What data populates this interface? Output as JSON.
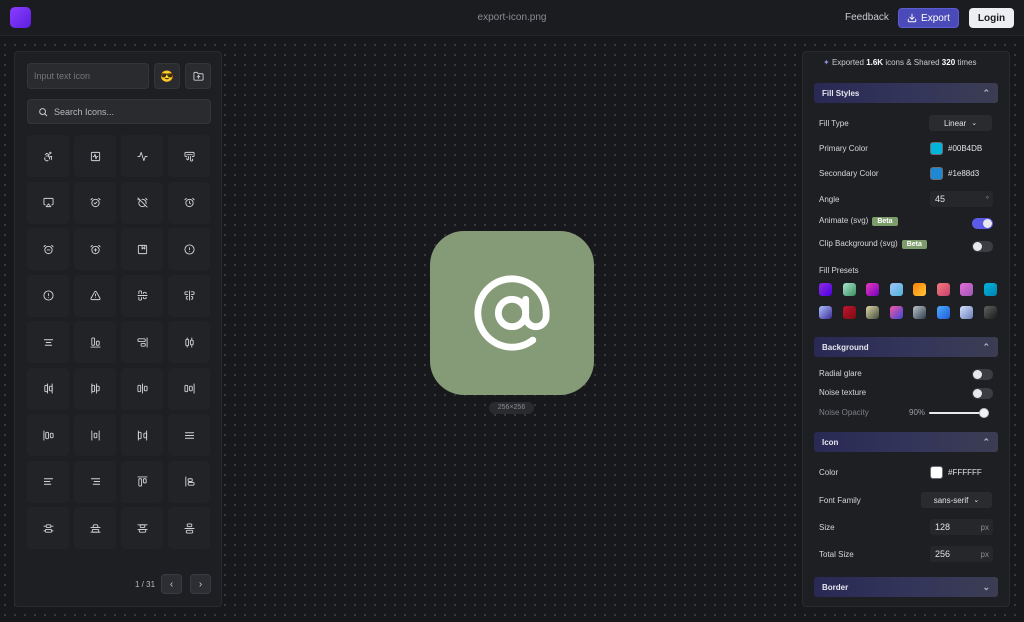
{
  "header": {
    "filename": "export-icon.png",
    "feedback_label": "Feedback",
    "export_label": "Export",
    "login_label": "Login"
  },
  "left": {
    "text_input_placeholder": "Input text icon",
    "emoji": "😎",
    "search_placeholder": "Search Icons...",
    "pagination": "1 / 31",
    "icons": [
      "accessibility-icon",
      "activity-square-icon",
      "activity-icon",
      "air-vent-icon",
      "airplay-icon",
      "alarm-check-icon",
      "alarm-clock-off-icon",
      "alarm-clock-icon",
      "alarm-minus-icon",
      "alarm-plus-icon",
      "album-icon",
      "alert-circle-icon",
      "alert-octagon-icon",
      "alert-triangle-icon",
      "align-center-horizontal-icon",
      "align-center-vertical-icon",
      "align-center-icon",
      "align-end-horizontal-icon",
      "align-end-vertical-icon",
      "align-horizontal-distribute-center-icon",
      "align-horizontal-distribute-end-icon",
      "align-horizontal-distribute-start-icon",
      "align-horizontal-justify-center-icon",
      "align-horizontal-justify-end-icon",
      "align-horizontal-justify-start-icon",
      "align-horizontal-space-around-icon",
      "align-horizontal-space-between-icon",
      "align-justify-icon",
      "align-left-icon",
      "align-right-icon",
      "align-start-horizontal-icon",
      "align-start-vertical-icon",
      "align-vertical-distribute-center-icon",
      "align-vertical-distribute-end-icon",
      "align-vertical-distribute-start-icon",
      "align-vertical-justify-center-icon",
      "blank-icon",
      "blank-icon",
      "blank-icon",
      "blank-icon"
    ]
  },
  "preview": {
    "background_color": "#859a76",
    "icon_color": "#FFFFFF",
    "icon": "at-sign-icon",
    "size_label": "256×256"
  },
  "right": {
    "stats": {
      "prefix": "Exported ",
      "exports": "1.6K",
      "middle": " icons & Shared ",
      "shares": "320",
      "suffix": " times"
    },
    "fill_styles": {
      "title": "Fill Styles",
      "fill_type_label": "Fill Type",
      "fill_type_value": "Linear",
      "primary_label": "Primary Color",
      "primary_value": "#00B4DB",
      "primary_swatch": "#00B4DB",
      "secondary_label": "Secondary Color",
      "secondary_value": "#1e88d3",
      "secondary_swatch": "#1e88d3",
      "angle_label": "Angle",
      "angle_value": "45",
      "angle_unit": "°",
      "animate_label": "Animate (svg)",
      "animate_badge": "Beta",
      "animate_on": true,
      "clip_label": "Clip Background (svg)",
      "clip_badge": "Beta",
      "clip_on": false,
      "presets_label": "Fill Presets",
      "presets": [
        "linear-gradient(135deg,#8e2de2,#4a00e0)",
        "linear-gradient(135deg,#a8e6cf,#3b8d5e)",
        "linear-gradient(135deg,#ec38bc,#7303c0)",
        "linear-gradient(135deg,#a1c4fd,#4fb3d9)",
        "linear-gradient(135deg,#ff8008,#ffc837)",
        "linear-gradient(135deg,#f7797d,#c6426e)",
        "linear-gradient(135deg,#e96bd8,#9b59b6)",
        "linear-gradient(135deg,#00b4db,#0083b0)",
        "linear-gradient(135deg,#a8c0ff,#3f2b96)",
        "linear-gradient(135deg,#c31432,#7a0d0d)",
        "linear-gradient(135deg,#e0d7a8,#3f4c3a)",
        "linear-gradient(135deg,#f857a6,#3a47d5)",
        "linear-gradient(135deg,#bdc3c7,#2c3e50)",
        "linear-gradient(135deg,#4facfe,#1e5bd8)",
        "linear-gradient(135deg,#d4e0ff,#6a7fb8)",
        "linear-gradient(135deg,#616161,#1a1a1a)"
      ]
    },
    "background": {
      "title": "Background",
      "radial_label": "Radial glare",
      "radial_on": false,
      "noise_label": "Noise texture",
      "noise_on": false,
      "opacity_label": "Noise Opacity",
      "opacity_value": "90%"
    },
    "icon": {
      "title": "Icon",
      "color_label": "Color",
      "color_value": "#FFFFFF",
      "color_swatch": "#FFFFFF",
      "font_label": "Font Family",
      "font_value": "sans-serif",
      "size_label": "Size",
      "size_value": "128",
      "size_unit": "px",
      "total_label": "Total Size",
      "total_value": "256",
      "total_unit": "px"
    },
    "border": {
      "title": "Border"
    }
  }
}
